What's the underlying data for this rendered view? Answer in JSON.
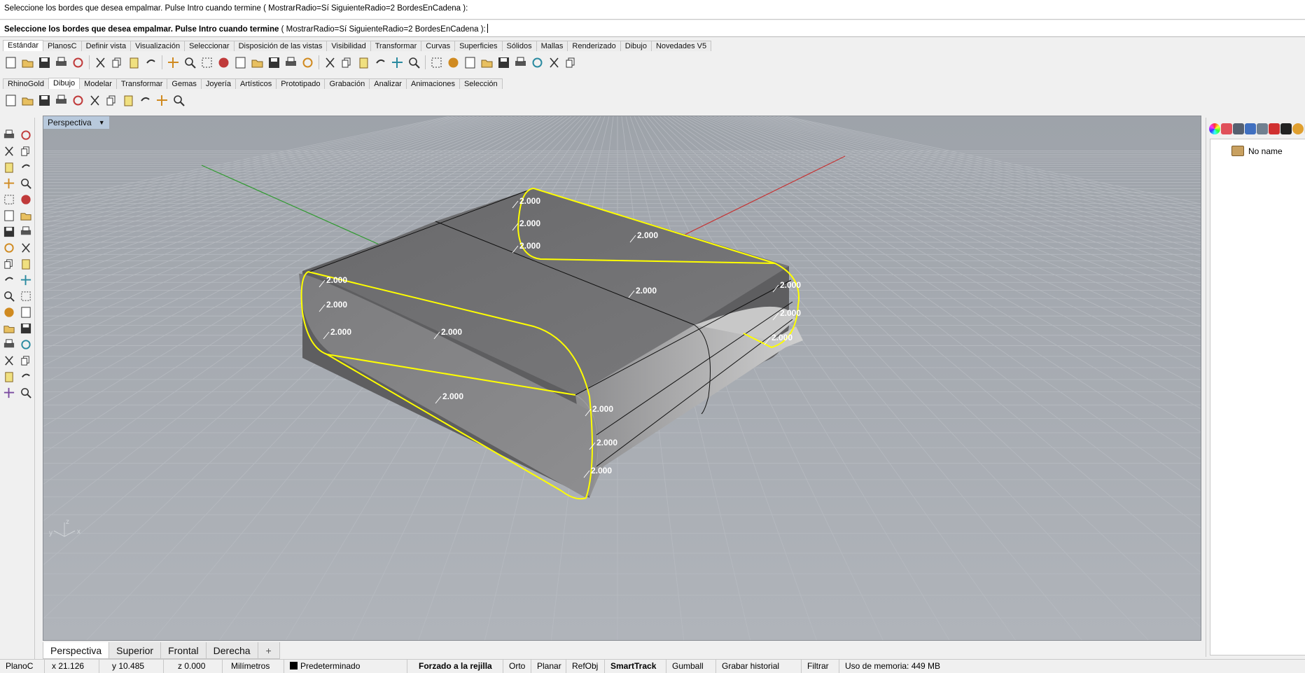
{
  "command": {
    "history": "Seleccione los bordes que desea empalmar. Pulse Intro cuando termine ( MostrarRadio=Sí  SiguienteRadio=2  BordesEnCadena ):",
    "prompt_bold": "Seleccione los bordes que desea empalmar. Pulse Intro cuando termine",
    "prompt_rest": " ( MostrarRadio=Sí  SiguienteRadio=2  BordesEnCadena ):"
  },
  "tabs1": [
    "Estándar",
    "PlanosC",
    "Definir vista",
    "Visualización",
    "Seleccionar",
    "Disposición de las vistas",
    "Visibilidad",
    "Transformar",
    "Curvas",
    "Superficies",
    "Sólidos",
    "Mallas",
    "Renderizado",
    "Dibujo",
    "Novedades V5"
  ],
  "tabs2": [
    "RhinoGold",
    "Dibujo",
    "Modelar",
    "Transformar",
    "Gemas",
    "Joyería",
    "Artísticos",
    "Prototipado",
    "Grabación",
    "Analizar",
    "Animaciones",
    "Selección"
  ],
  "toolbar1_icons": [
    "new-icon",
    "open-icon",
    "save-icon",
    "print-icon",
    "import-icon",
    "cut-icon",
    "copy-icon",
    "paste-icon",
    "undo-icon",
    "pan-icon",
    "rotate-view-icon",
    "zoom-icon",
    "zoom-window-icon",
    "zoom-extents-icon",
    "zoom-selected-icon",
    "rotate-icon",
    "grid-icon",
    "car-icon",
    "shade-icon",
    "point-icon",
    "properties-icon",
    "light-icon",
    "lock-icon",
    "layer-icon",
    "color-wheel-icon",
    "material-sphere-icon",
    "render-sphere-icon",
    "env-sphere-icon",
    "blue-sphere-icon",
    "pin-icon",
    "gear-icon",
    "options-icon",
    "help-icon"
  ],
  "toolbar2_icons": [
    "points-icon",
    "curve-icon",
    "lasso-icon",
    "target-icon",
    "molecule-icon",
    "rainbow-icon",
    "text-abc-icon",
    "pipe-icon",
    "pipe2-icon",
    "gear-star-icon",
    "star-icon"
  ],
  "viewport": {
    "label": "Perspectiva",
    "dims": [
      {
        "text": "2.000"
      },
      {
        "text": "2.000"
      },
      {
        "text": "2.000"
      },
      {
        "text": "2.000"
      },
      {
        "text": "2.000"
      },
      {
        "text": "2.000"
      },
      {
        "text": "2.000"
      },
      {
        "text": "2.000"
      },
      {
        "text": "2.000"
      },
      {
        "text": "2.000"
      },
      {
        "text": "2.000"
      },
      {
        "text": "2.000"
      },
      {
        "text": "2.000"
      },
      {
        "text": "2.000"
      },
      {
        "text": "2.000"
      },
      {
        "text": "2.000"
      }
    ],
    "axis_labels": {
      "z": "z",
      "y": "y",
      "x": "x"
    }
  },
  "view_tabs": [
    "Perspectiva",
    "Superior",
    "Frontal",
    "Derecha"
  ],
  "add_tab": "+",
  "status": {
    "plane": "PlanoC",
    "x": "x 21.126",
    "y": "y 10.485",
    "z": "z 0.000",
    "units": "Milímetros",
    "layer": "Predeterminado",
    "snap": "Forzado a la rejilla",
    "ortho": "Orto",
    "planar": "Planar",
    "osnap": "RefObj",
    "smarttrack": "SmartTrack",
    "gumball": "Gumball",
    "history": "Grabar historial",
    "filter": "Filtrar",
    "memory": "Uso de memoria: 449 MB"
  },
  "layers": {
    "root": "No name"
  },
  "colors": {
    "selection": "#ffff00",
    "x_axis": "#c03030",
    "y_axis": "#30a030",
    "viewport_bg": "#a8acb2"
  }
}
